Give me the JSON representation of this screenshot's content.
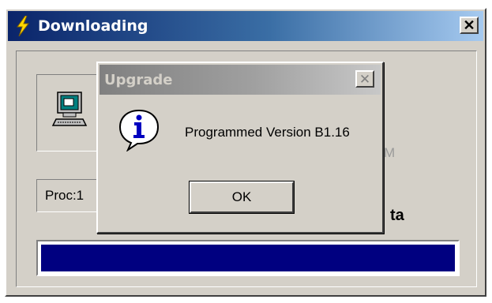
{
  "main_window": {
    "title": "Downloading",
    "close_label": "✕",
    "title_icon": "lightning-icon",
    "faded_fragment": "M",
    "proc_field": "Proc:1",
    "bold_fragment": "ta",
    "progress_fraction": 1.0,
    "colors": {
      "title_start": "#0a246a",
      "progress": "#000080"
    }
  },
  "dialog": {
    "title": "Upgrade",
    "close_label": "✕",
    "icon": "info-icon",
    "message": "Programmed Version B1.16",
    "ok_label": "OK"
  }
}
